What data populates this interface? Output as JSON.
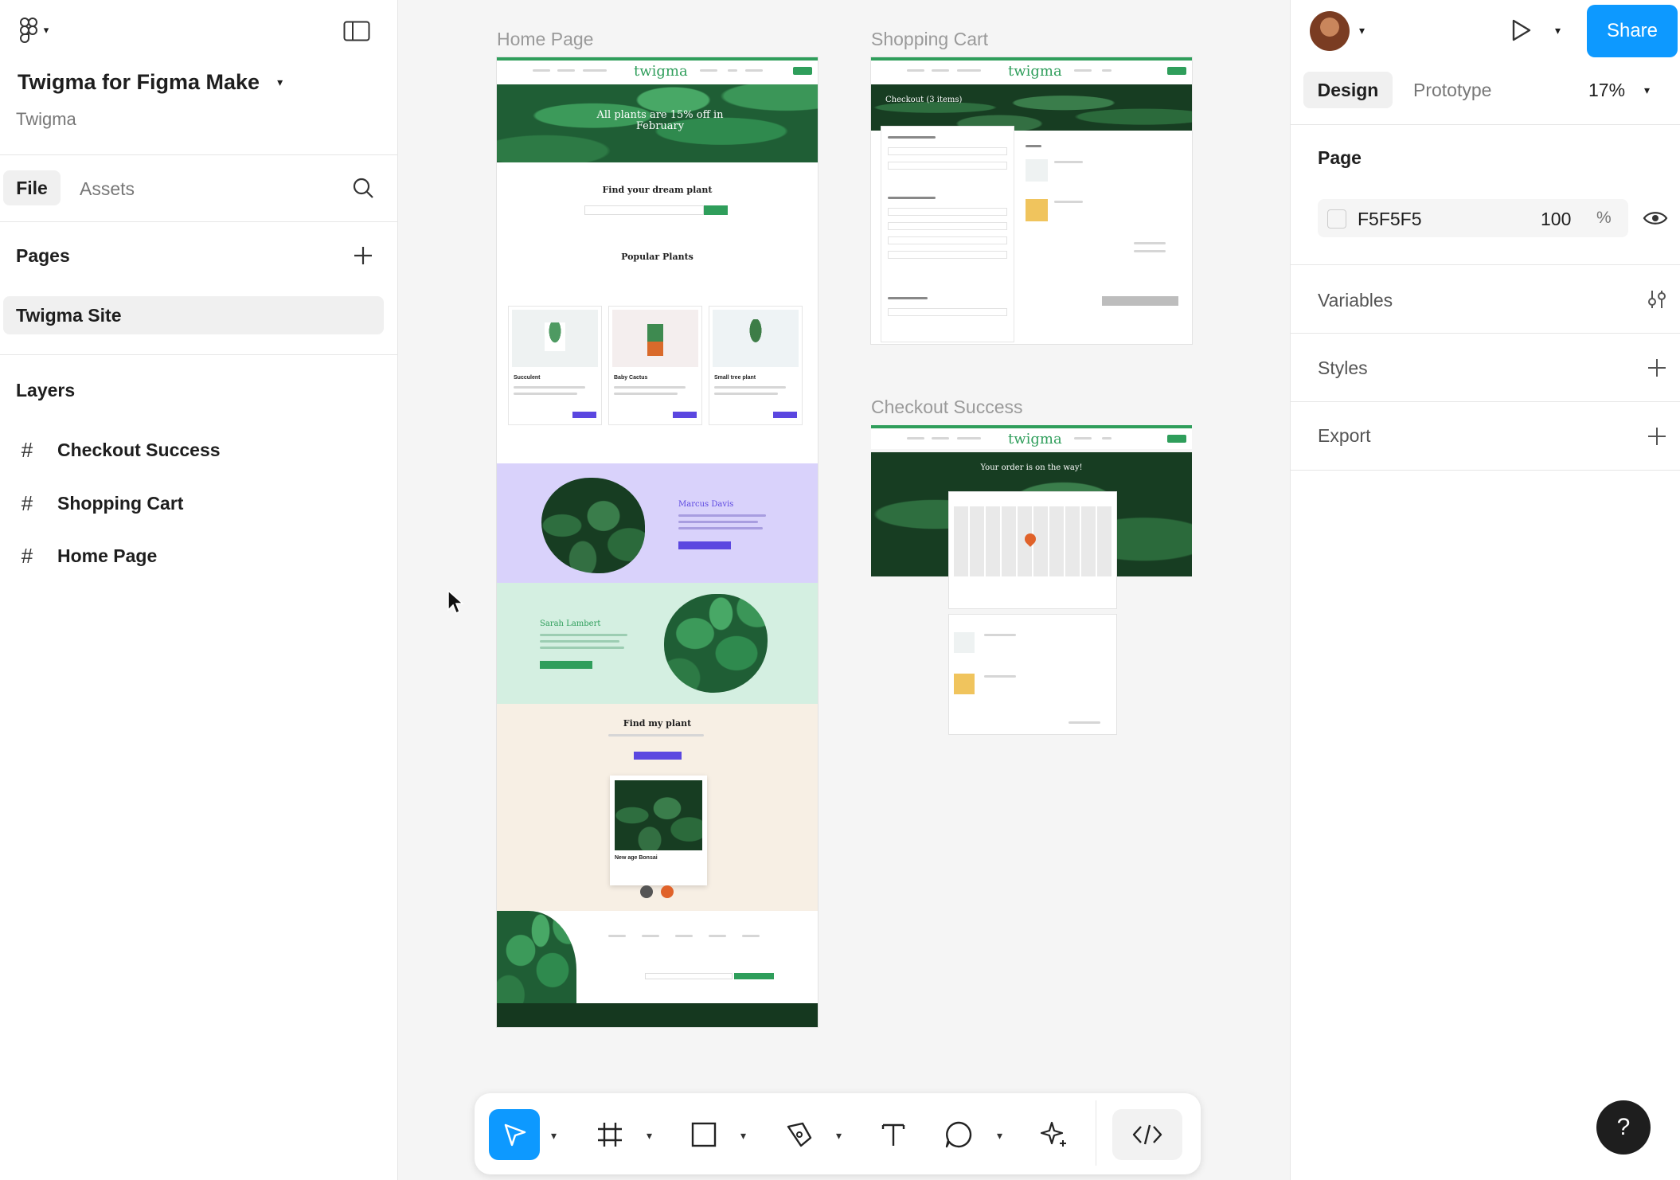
{
  "app": {
    "file_title": "Twigma for Figma Make",
    "team": "Twigma",
    "panel_tabs": [
      "File",
      "Assets"
    ]
  },
  "pages": {
    "heading": "Pages",
    "items": [
      "Twigma Site"
    ]
  },
  "layers": {
    "heading": "Layers",
    "items": [
      "Checkout Success",
      "Shopping Cart",
      "Home Page"
    ]
  },
  "canvas": {
    "frames": [
      "Home Page",
      "Shopping Cart",
      "Checkout Success"
    ],
    "home": {
      "brand": "twigma",
      "hero": "All plants are 15% off in February",
      "find_title": "Find your dream plant",
      "popular_title": "Popular Plants",
      "products": [
        "Succulent",
        "Baby Cactus",
        "Small tree plant"
      ],
      "testimonial_1": "Marcus Davis",
      "testimonial_2": "Sarah Lambert",
      "quiz_title": "Find my plant",
      "quiz_item": "New age Bonsai"
    },
    "cart": {
      "brand": "twigma",
      "title": "Checkout (3 items)"
    },
    "success": {
      "brand": "twigma",
      "title": "Your order is on the way!"
    }
  },
  "right_panel": {
    "tabs": [
      "Design",
      "Prototype"
    ],
    "zoom": "17%",
    "share_label": "Share",
    "page_heading": "Page",
    "page_fill_hex": "F5F5F5",
    "page_fill_opacity": "100",
    "percent_sign": "%",
    "sections": [
      "Variables",
      "Styles",
      "Export"
    ]
  },
  "help_label": "?",
  "colors": {
    "accent": "#0d99ff",
    "brand_green": "#2f9e5b",
    "testimonial_purple": "#d9d2fb",
    "testimonial_mint": "#d4efe1",
    "quiz_cream": "#f7efe4"
  }
}
